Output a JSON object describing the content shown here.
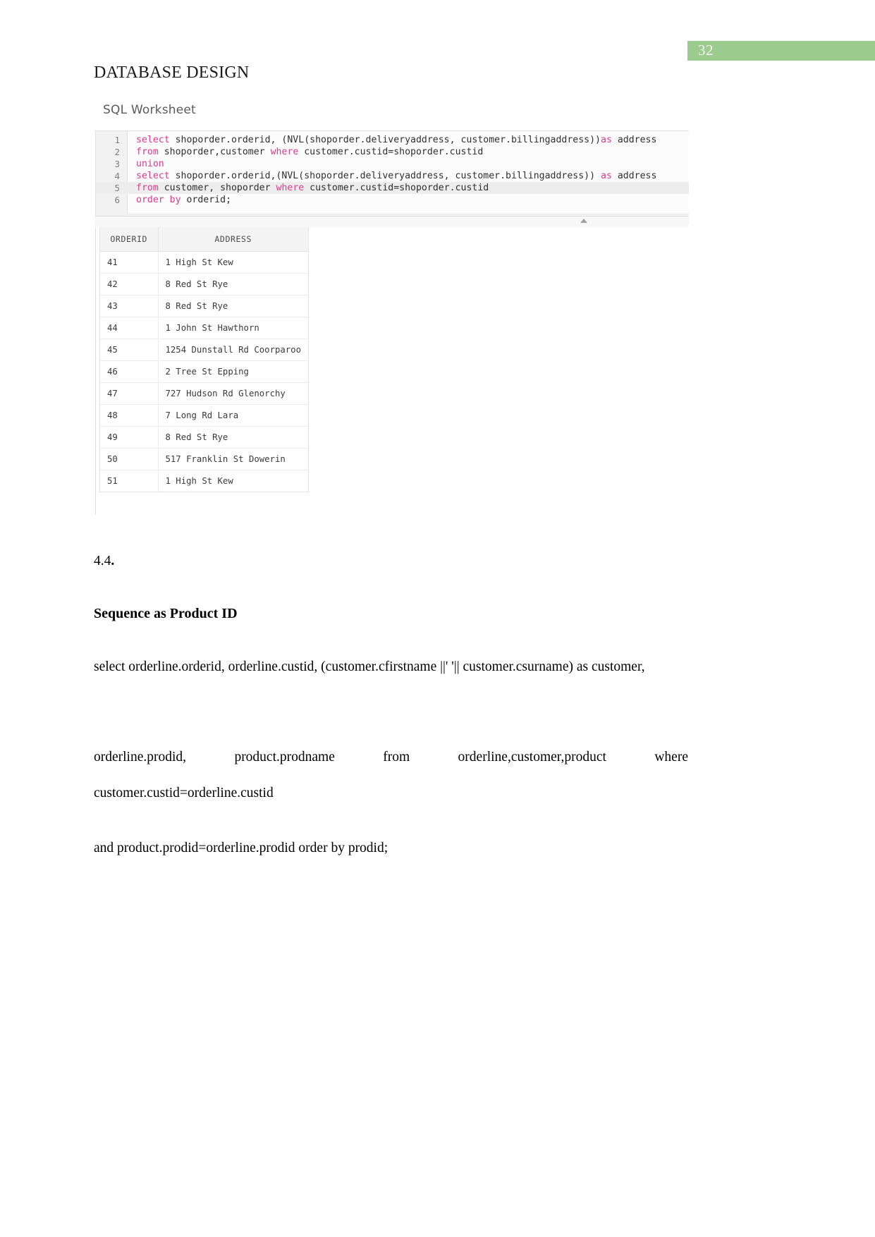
{
  "page": {
    "number": "32",
    "badge_color": "#9ccb8e",
    "title": "DATABASE DESIGN"
  },
  "figure": {
    "worksheet_label": "SQL Worksheet",
    "code": {
      "lines": [
        {
          "number": "1",
          "active": false,
          "tokens": [
            {
              "t": "select",
              "k": "kw"
            },
            {
              "t": " shoporder.orderid, (NVL(shoporder.deliveryaddress, customer.billingaddress))",
              "k": ""
            },
            {
              "t": "as",
              "k": "kw"
            },
            {
              "t": " address",
              "k": ""
            }
          ]
        },
        {
          "number": "2",
          "active": false,
          "tokens": [
            {
              "t": "from",
              "k": "kw"
            },
            {
              "t": " shoporder,customer ",
              "k": ""
            },
            {
              "t": "where",
              "k": "kw"
            },
            {
              "t": " customer.custid=shoporder.custid",
              "k": ""
            }
          ]
        },
        {
          "number": "3",
          "active": false,
          "tokens": [
            {
              "t": "union",
              "k": "kw"
            }
          ]
        },
        {
          "number": "4",
          "active": false,
          "tokens": [
            {
              "t": "select",
              "k": "kw"
            },
            {
              "t": " shoporder.orderid,(NVL(shoporder.deliveryaddress, customer.billingaddress)) ",
              "k": ""
            },
            {
              "t": "as",
              "k": "kw"
            },
            {
              "t": " address",
              "k": ""
            }
          ]
        },
        {
          "number": "5",
          "active": true,
          "tokens": [
            {
              "t": "from",
              "k": "kw"
            },
            {
              "t": " customer, shoporder ",
              "k": ""
            },
            {
              "t": "where",
              "k": "kw"
            },
            {
              "t": " customer.custid=shoporder.custid",
              "k": ""
            }
          ]
        },
        {
          "number": "6",
          "active": false,
          "tokens": [
            {
              "t": "order",
              "k": "kw"
            },
            {
              "t": " ",
              "k": ""
            },
            {
              "t": "by",
              "k": "kw"
            },
            {
              "t": " orderid;",
              "k": ""
            }
          ]
        }
      ]
    },
    "results": {
      "columns": [
        "ORDERID",
        "ADDRESS"
      ],
      "rows": [
        [
          "41",
          "1 High St Kew"
        ],
        [
          "42",
          "8 Red St Rye"
        ],
        [
          "43",
          "8 Red St Rye"
        ],
        [
          "44",
          "1 John St Hawthorn"
        ],
        [
          "45",
          "1254 Dunstall Rd Coorparoo"
        ],
        [
          "46",
          "2 Tree St Epping"
        ],
        [
          "47",
          "727 Hudson Rd Glenorchy"
        ],
        [
          "48",
          "7 Long Rd Lara"
        ],
        [
          "49",
          "8 Red St Rye"
        ],
        [
          "50",
          "517 Franklin St Dowerin"
        ],
        [
          "51",
          "1 High St Kew"
        ]
      ]
    }
  },
  "content": {
    "section_number": "4.4",
    "section_number_suffix": ".",
    "section_heading": "Sequence as Product ID",
    "paragraph_1": "select  orderline.orderid,  orderline.custid,  (customer.cfirstname  ||' '||  customer.csurname)  as customer,",
    "paragraph_2": "orderline.prodid, product.prodname from orderline,customer,product where customer.custid=orderline.custid",
    "paragraph_3": "and product.prodid=orderline.prodid order by prodid;"
  }
}
